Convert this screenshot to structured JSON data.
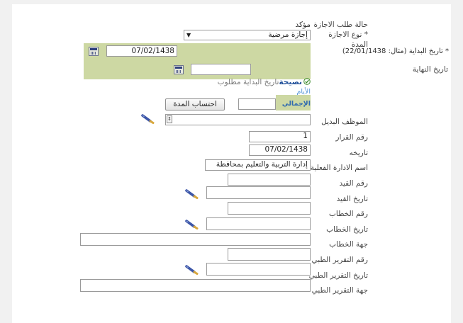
{
  "request_status": {
    "label": "حالة طلب الاجازة",
    "value": "مؤكد"
  },
  "leave_type": {
    "label": "* نوع الاجازة",
    "value": "إجازة مرضية"
  },
  "duration": {
    "label": "المدة",
    "start_label": "* تاريخ البداية (مثال: 22/01/1438)",
    "start_value": "07/02/1438",
    "end_label": "تاريخ النهاية",
    "end_value": "",
    "hint_title": "نصيحة",
    "hint_text": "تاريخ البداية مطلوب",
    "days_label": "الأيام",
    "total_label": "الإجمالي",
    "total_value": "",
    "calc_button": "احتساب المدة"
  },
  "substitute_employee": {
    "label": "الموظف البديل",
    "value": ""
  },
  "decision_number": {
    "label": "رقم القرار",
    "value": "1"
  },
  "decision_date": {
    "label": "تاريخه",
    "value": "07/02/1438"
  },
  "department_name": {
    "label": "اسم الادارة الفعلية",
    "value": "إدارة التربية والتعليم بمحافظة"
  },
  "registration_number": {
    "label": "رقم القيد",
    "value": ""
  },
  "registration_date": {
    "label": "تاريخ القيد",
    "value": ""
  },
  "letter_number": {
    "label": "رقم الخطاب",
    "value": ""
  },
  "letter_date": {
    "label": "تاريخ الخطاب",
    "value": ""
  },
  "letter_authority": {
    "label": "جهة الخطاب",
    "value": ""
  },
  "medical_report_number": {
    "label": "رقم التقرير الطبي",
    "value": ""
  },
  "medical_report_date": {
    "label": "تاريخ التقرير الطبي",
    "value": ""
  },
  "medical_report_authority": {
    "label": "جهة التقرير الطبي",
    "value": ""
  },
  "icons": {
    "calendar": "calendar-icon",
    "pen": "pen-icon",
    "dropdown": "chevron-down-icon",
    "check": "check-icon"
  }
}
